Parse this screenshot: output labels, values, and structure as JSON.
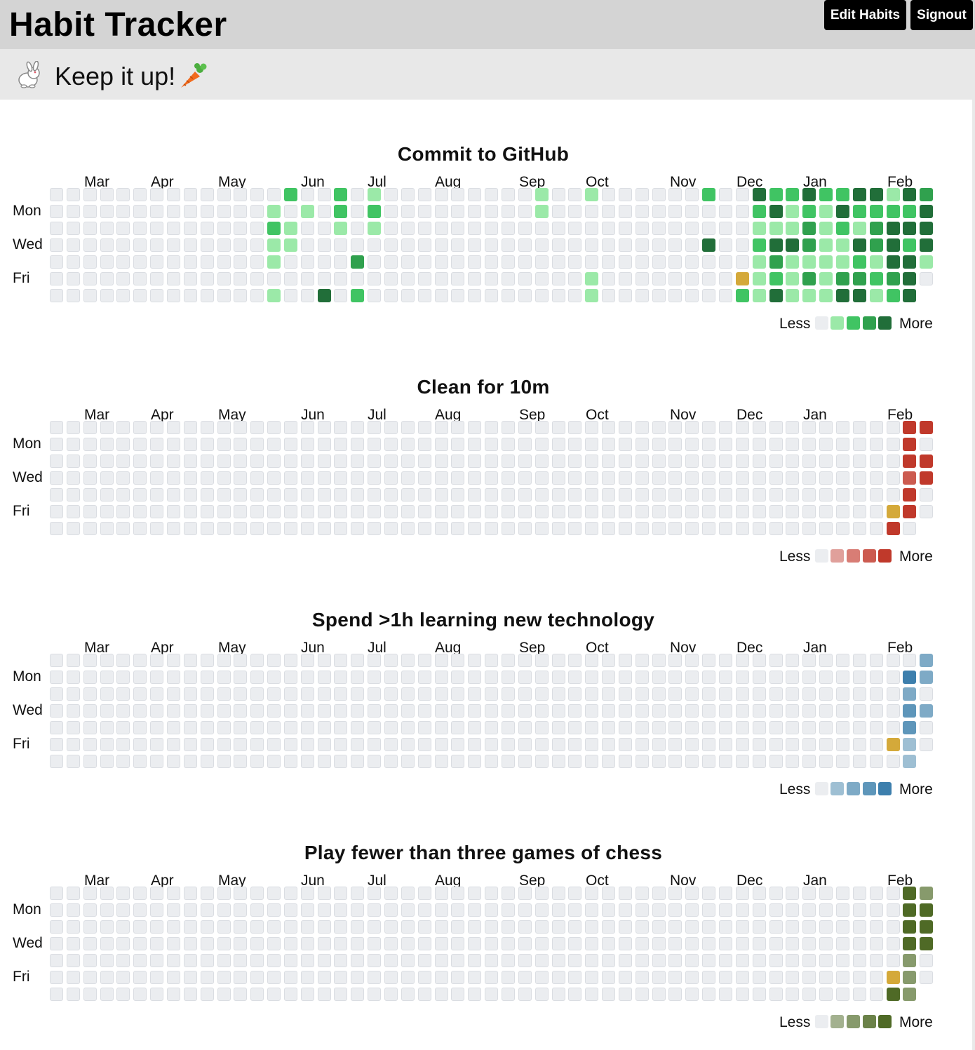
{
  "header": {
    "title": "Habit Tracker",
    "edit_label": "Edit Habits",
    "signout_label": "Signout"
  },
  "banner": {
    "message": "Keep it up!",
    "left_icon": "bunny-icon",
    "right_icon": "carrot-icon"
  },
  "months": [
    "Mar",
    "Apr",
    "May",
    "Jun",
    "Jul",
    "Aug",
    "Sep",
    "Oct",
    "Nov",
    "Dec",
    "Jan",
    "Feb"
  ],
  "day_labels": [
    "Mon",
    "Wed",
    "Fri"
  ],
  "legend": {
    "less": "Less",
    "more": "More"
  },
  "empty_color": "#ebedf0",
  "skip_color": "#d4a93a",
  "habits": [
    {
      "title": "Commit to GitHub",
      "palette": [
        "#ebedf0",
        "#9be9a8",
        "#40c463",
        "#30a14e",
        "#216e39"
      ],
      "active": [
        [
          14,
          0,
          2
        ],
        [
          17,
          0,
          2
        ],
        [
          19,
          0,
          1
        ],
        [
          29,
          0,
          1
        ],
        [
          32,
          0,
          1
        ],
        [
          39,
          0,
          2
        ],
        [
          42,
          0,
          4
        ],
        [
          43,
          0,
          2
        ],
        [
          44,
          0,
          2
        ],
        [
          45,
          0,
          4
        ],
        [
          46,
          0,
          2
        ],
        [
          47,
          0,
          2
        ],
        [
          48,
          0,
          4
        ],
        [
          49,
          0,
          4
        ],
        [
          50,
          0,
          1
        ],
        [
          51,
          0,
          4
        ],
        [
          52,
          0,
          3
        ],
        [
          13,
          1,
          1
        ],
        [
          15,
          1,
          1
        ],
        [
          17,
          1,
          2
        ],
        [
          19,
          1,
          2
        ],
        [
          29,
          1,
          1
        ],
        [
          42,
          1,
          2
        ],
        [
          43,
          1,
          4
        ],
        [
          44,
          1,
          1
        ],
        [
          45,
          1,
          2
        ],
        [
          46,
          1,
          1
        ],
        [
          47,
          1,
          4
        ],
        [
          48,
          1,
          2
        ],
        [
          49,
          1,
          2
        ],
        [
          50,
          1,
          2
        ],
        [
          51,
          1,
          2
        ],
        [
          52,
          1,
          4
        ],
        [
          13,
          2,
          2
        ],
        [
          14,
          2,
          1
        ],
        [
          17,
          2,
          1
        ],
        [
          19,
          2,
          1
        ],
        [
          42,
          2,
          1
        ],
        [
          43,
          2,
          1
        ],
        [
          44,
          2,
          1
        ],
        [
          45,
          2,
          3
        ],
        [
          46,
          2,
          1
        ],
        [
          47,
          2,
          2
        ],
        [
          48,
          2,
          1
        ],
        [
          49,
          2,
          3
        ],
        [
          50,
          2,
          4
        ],
        [
          51,
          2,
          4
        ],
        [
          52,
          2,
          4
        ],
        [
          13,
          3,
          1
        ],
        [
          14,
          3,
          1
        ],
        [
          39,
          3,
          4
        ],
        [
          42,
          3,
          2
        ],
        [
          43,
          3,
          4
        ],
        [
          44,
          3,
          4
        ],
        [
          45,
          3,
          3
        ],
        [
          46,
          3,
          1
        ],
        [
          47,
          3,
          1
        ],
        [
          48,
          3,
          4
        ],
        [
          49,
          3,
          3
        ],
        [
          50,
          3,
          4
        ],
        [
          51,
          3,
          2
        ],
        [
          52,
          3,
          4
        ],
        [
          13,
          4,
          1
        ],
        [
          18,
          4,
          3
        ],
        [
          42,
          4,
          1
        ],
        [
          43,
          4,
          3
        ],
        [
          44,
          4,
          1
        ],
        [
          45,
          4,
          1
        ],
        [
          46,
          4,
          1
        ],
        [
          47,
          4,
          1
        ],
        [
          48,
          4,
          2
        ],
        [
          49,
          4,
          1
        ],
        [
          50,
          4,
          4
        ],
        [
          51,
          4,
          4
        ],
        [
          52,
          4,
          1
        ],
        [
          32,
          5,
          1
        ],
        [
          41,
          5,
          "skip"
        ],
        [
          42,
          5,
          1
        ],
        [
          43,
          5,
          2
        ],
        [
          44,
          5,
          1
        ],
        [
          45,
          5,
          3
        ],
        [
          46,
          5,
          1
        ],
        [
          47,
          5,
          3
        ],
        [
          48,
          5,
          3
        ],
        [
          49,
          5,
          2
        ],
        [
          50,
          5,
          3
        ],
        [
          51,
          5,
          4
        ],
        [
          13,
          6,
          1
        ],
        [
          16,
          6,
          4
        ],
        [
          18,
          6,
          2
        ],
        [
          32,
          6,
          1
        ],
        [
          41,
          6,
          2
        ],
        [
          42,
          6,
          1
        ],
        [
          43,
          6,
          4
        ],
        [
          44,
          6,
          1
        ],
        [
          45,
          6,
          1
        ],
        [
          46,
          6,
          1
        ],
        [
          47,
          6,
          4
        ],
        [
          48,
          6,
          4
        ],
        [
          49,
          6,
          1
        ],
        [
          50,
          6,
          2
        ],
        [
          51,
          6,
          4
        ]
      ]
    },
    {
      "title": "Clean for 10m",
      "palette": [
        "#ebedf0",
        "#e0a09b",
        "#d87d75",
        "#cc5b50",
        "#c0392b"
      ],
      "active": [
        [
          51,
          0,
          4
        ],
        [
          52,
          0,
          4
        ],
        [
          51,
          1,
          4
        ],
        [
          51,
          2,
          4
        ],
        [
          52,
          2,
          4
        ],
        [
          51,
          3,
          3
        ],
        [
          52,
          3,
          4
        ],
        [
          51,
          4,
          4
        ],
        [
          50,
          5,
          "skip"
        ],
        [
          51,
          5,
          4
        ],
        [
          50,
          6,
          4
        ]
      ]
    },
    {
      "title": "Spend >1h learning new technology",
      "palette": [
        "#ebedf0",
        "#9ebfd3",
        "#7eaac6",
        "#5e96ba",
        "#3d7fad"
      ],
      "active": [
        [
          52,
          0,
          2
        ],
        [
          51,
          1,
          4
        ],
        [
          52,
          1,
          2
        ],
        [
          51,
          2,
          2
        ],
        [
          51,
          3,
          3
        ],
        [
          52,
          3,
          2
        ],
        [
          51,
          4,
          3
        ],
        [
          50,
          5,
          "skip"
        ],
        [
          51,
          5,
          1
        ],
        [
          51,
          6,
          1
        ]
      ]
    },
    {
      "title": "Play fewer than three games of chess",
      "palette": [
        "#ebedf0",
        "#a3b18f",
        "#879a6c",
        "#6b8249",
        "#4f6a26"
      ],
      "active": [
        [
          51,
          0,
          4
        ],
        [
          52,
          0,
          2
        ],
        [
          51,
          1,
          4
        ],
        [
          52,
          1,
          4
        ],
        [
          51,
          2,
          4
        ],
        [
          52,
          2,
          4
        ],
        [
          51,
          3,
          4
        ],
        [
          52,
          3,
          4
        ],
        [
          51,
          4,
          2
        ],
        [
          50,
          5,
          "skip"
        ],
        [
          51,
          5,
          2
        ],
        [
          50,
          6,
          4
        ],
        [
          51,
          6,
          2
        ]
      ]
    }
  ]
}
